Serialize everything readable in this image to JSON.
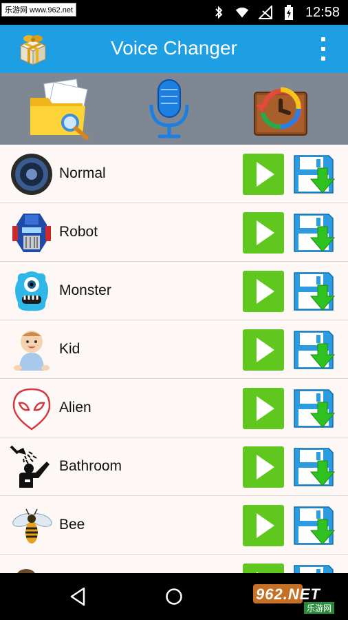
{
  "status_bar": {
    "watermark": "乐游网 www.962.net",
    "time": "12:58",
    "icons": [
      "bluetooth-icon",
      "wifi-icon",
      "no-signal-icon",
      "battery-charging-icon"
    ]
  },
  "app_bar": {
    "title": "Voice Changer",
    "gift_icon": "gift-box-icon",
    "menu_icon": "overflow-menu-icon"
  },
  "toolbar": {
    "items": [
      {
        "icon": "folder-search-icon"
      },
      {
        "icon": "microphone-icon"
      },
      {
        "icon": "history-icon"
      }
    ]
  },
  "effects": [
    {
      "label": "Normal",
      "icon": "speaker-icon"
    },
    {
      "label": "Robot",
      "icon": "robot-icon"
    },
    {
      "label": "Monster",
      "icon": "monster-icon"
    },
    {
      "label": "Kid",
      "icon": "baby-icon"
    },
    {
      "label": "Alien",
      "icon": "alien-icon"
    },
    {
      "label": "Bathroom",
      "icon": "shower-icon"
    },
    {
      "label": "Bee",
      "icon": "bee-icon"
    },
    {
      "label": "",
      "icon": "partial-row-icon"
    }
  ],
  "colors": {
    "app_bar": "#1e9fe3",
    "toolbar": "#7f8793",
    "play_button": "#5fc71e",
    "save_icon": "#2d9be0",
    "download_arrow": "#2ec11f"
  },
  "nav_bar": {
    "watermark_main": "962.NET",
    "watermark_sub": "乐游网"
  }
}
